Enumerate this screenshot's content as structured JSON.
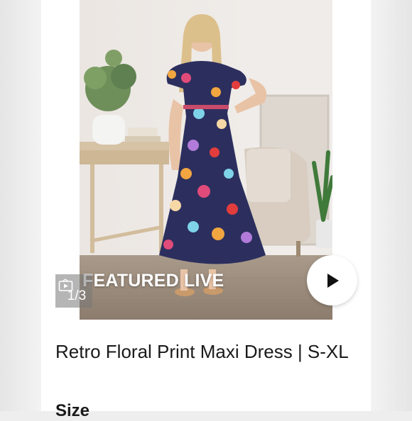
{
  "listing": {
    "media_badge": "FEATURED LIVE",
    "counter": "1/3",
    "title": "Retro Floral Print Maxi Dress | S-XL",
    "size_label": "Size"
  },
  "icons": {
    "play": "play-icon",
    "video": "video-icon"
  },
  "colors": {
    "background": "#eeeeee",
    "card": "#ffffff",
    "text": "#1a1a1a",
    "dress_base": "#2c2f5e"
  }
}
